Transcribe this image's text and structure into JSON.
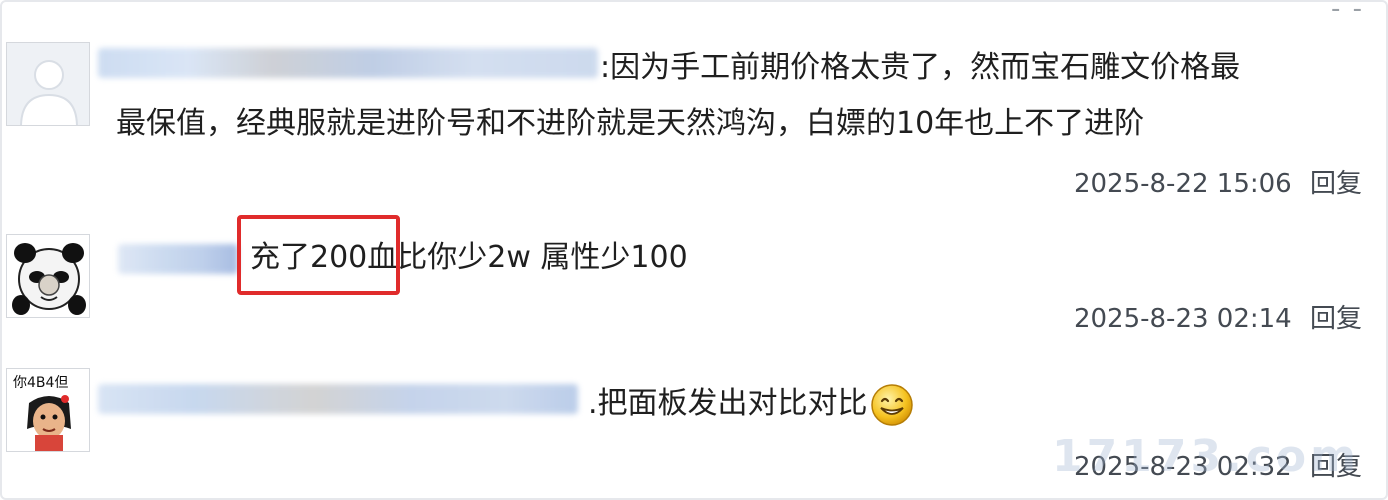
{
  "top_fragment": "- -",
  "comments": [
    {
      "text_line1": ":因为手工前期价格太贵了，然而宝石雕文价格最",
      "text_line2": "最保值，经典服就是进阶号和不进阶就是天然鸿沟，白嫖的10年也上不了进阶",
      "timestamp": "2025-8-22 15:06",
      "reply_label": "回复",
      "avatar": "default-person-icon"
    },
    {
      "text": "充了200血比你少2w 属性少100",
      "timestamp": "2025-8-23 02:14",
      "reply_label": "回复",
      "avatar": "panda-meme-icon"
    },
    {
      "text": ".把面板发出对比对比",
      "timestamp": "2025-8-23 02:32",
      "reply_label": "回复",
      "avatar": "cartoon-girl-meme-icon",
      "avatar_caption": "你4B4但",
      "emoji": "smiley-face-icon"
    }
  ],
  "watermark": "17173.com",
  "colors": {
    "highlight": "#e02b2b",
    "text": "#1f1f1f",
    "meta": "#444a52",
    "blur_blue": "#a9c3e8",
    "blur_gray": "#bdbdbd"
  }
}
